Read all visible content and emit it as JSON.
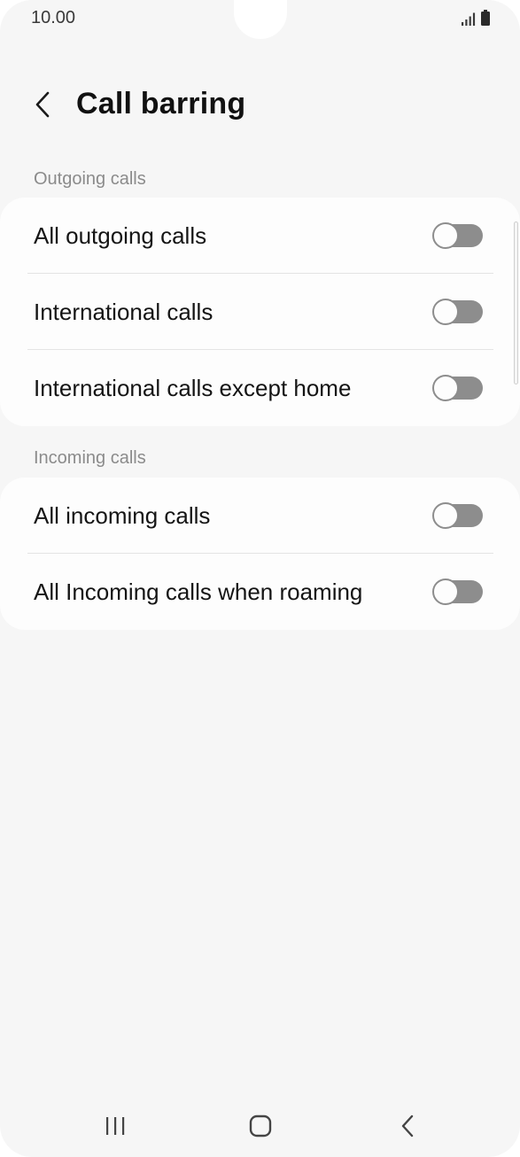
{
  "status_bar": {
    "time": "10.00",
    "icons": [
      "signal-icon",
      "battery-icon"
    ]
  },
  "header": {
    "back_icon": "chevron-left-icon",
    "title": "Call barring"
  },
  "sections": [
    {
      "label": "Outgoing calls",
      "items": [
        {
          "label": "All outgoing calls",
          "enabled": false
        },
        {
          "label": "International calls",
          "enabled": false
        },
        {
          "label": "International calls except home",
          "enabled": false
        }
      ]
    },
    {
      "label": "Incoming calls",
      "items": [
        {
          "label": "All incoming calls",
          "enabled": false
        },
        {
          "label": "All Incoming calls when roaming",
          "enabled": false
        }
      ]
    }
  ],
  "nav_bar": {
    "icons": [
      "recent-apps-icon",
      "home-icon",
      "back-icon"
    ]
  },
  "colors": {
    "background": "#f6f6f6",
    "card": "#fdfdfd",
    "switch_off": "#8d8d8d",
    "section_label": "#8b8b8b"
  }
}
